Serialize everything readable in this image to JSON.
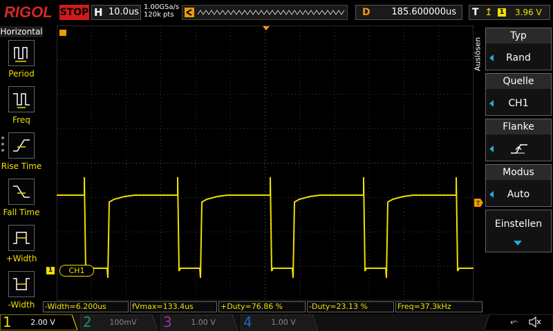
{
  "topbar": {
    "brand": "RIGOL",
    "run_state": "STOP",
    "timebase_label": "H",
    "timebase": "10.0us",
    "sample_rate": "1.00GSa/s",
    "memory_depth": "120k pts",
    "delay_label": "D",
    "delay": "185.600000us",
    "trigger_label": "T",
    "trigger_edge_icon": "rising-edge-icon",
    "trigger_source": "1",
    "trigger_level": "3.96 V"
  },
  "left_panel": {
    "title": "Horizontal",
    "items": [
      {
        "label": "Period",
        "icon": "period-icon"
      },
      {
        "label": "Freq",
        "icon": "freq-icon"
      },
      {
        "label": "Rise Time",
        "icon": "rise-time-icon"
      },
      {
        "label": "Fall Time",
        "icon": "fall-time-icon"
      },
      {
        "label": "+Width",
        "icon": "pos-width-icon"
      },
      {
        "label": "-Width",
        "icon": "neg-width-icon"
      }
    ]
  },
  "right_menu": {
    "side_label": "Auslösen",
    "items": [
      {
        "header": "Typ",
        "value": "Rand"
      },
      {
        "header": "Quelle",
        "value": "CH1"
      },
      {
        "header": "Flanke",
        "value": "",
        "value_icon": "rising-edge-icon"
      },
      {
        "header": "Modus",
        "value": "Auto"
      },
      {
        "header": "Einstellen",
        "value": ""
      }
    ]
  },
  "trace": {
    "channel_label": "CH1",
    "channel_marker": "1",
    "color": "#f0e000"
  },
  "measurements": [
    "-Width=6.200us",
    "fVmax=133.4us",
    "+Duty=76.86 %",
    "-Duty=23.13 %",
    "Freq=37.3kHz"
  ],
  "channels": [
    {
      "num": "1",
      "scale": "2.00 V",
      "color": "#f0e000",
      "active": true
    },
    {
      "num": "2",
      "scale": "100mV",
      "color": "#2a8a7a",
      "active": false
    },
    {
      "num": "3",
      "scale": "1.00 V",
      "color": "#a030a0",
      "active": false
    },
    {
      "num": "4",
      "scale": "1.00 V",
      "color": "#2a60c0",
      "active": false
    }
  ],
  "colors": {
    "brand": "#d8282a",
    "stop": "#d21a1a",
    "accent": "#2aa8e0",
    "trigger": "#f09a00",
    "ch1": "#f0e000"
  },
  "status_icons": [
    "usb-icon",
    "speaker-mute-icon"
  ]
}
